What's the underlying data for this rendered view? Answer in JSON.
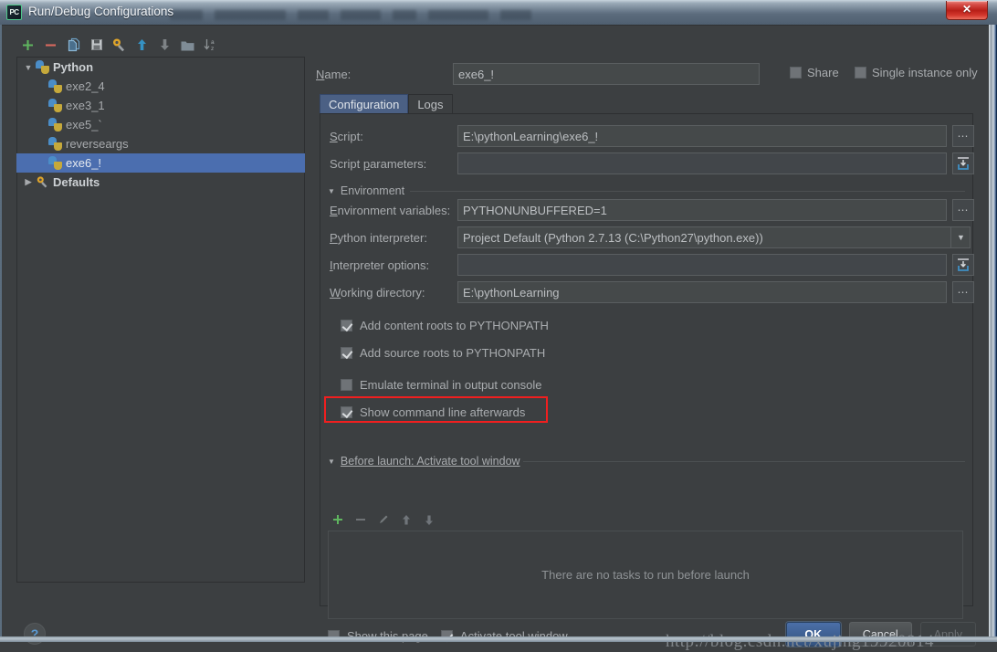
{
  "window": {
    "title": "Run/Debug Configurations",
    "app_icon": "pycharm-icon",
    "close_label": "✕",
    "ghost_menu_widths": [
      36,
      78,
      34,
      44,
      26,
      66,
      34
    ]
  },
  "tree_toolbar": {
    "buttons": [
      {
        "name": "add-configuration-button",
        "icon": "plus-icon",
        "tooltip": "Add New Configuration"
      },
      {
        "name": "remove-configuration-button",
        "icon": "minus-icon",
        "tooltip": "Remove Configuration"
      },
      {
        "name": "copy-configuration-button",
        "icon": "copy-icon",
        "tooltip": "Copy Configuration"
      },
      {
        "name": "save-configuration-button",
        "icon": "save-icon",
        "tooltip": "Save Configuration"
      },
      {
        "name": "edit-defaults-button",
        "icon": "wrench-icon",
        "tooltip": "Edit Defaults"
      },
      {
        "name": "move-up-button",
        "icon": "arrow-up-icon",
        "tooltip": "Move Up"
      },
      {
        "name": "move-down-button",
        "icon": "arrow-down-icon",
        "tooltip": "Move Down"
      },
      {
        "name": "create-folder-button",
        "icon": "folder-icon",
        "tooltip": "Create New Folder"
      },
      {
        "name": "sort-button",
        "icon": "sort-az-icon",
        "tooltip": "Sort Configurations"
      }
    ]
  },
  "tree": {
    "nodes": [
      {
        "label": "Python",
        "type": "group",
        "expanded": true,
        "icon": "python-icon",
        "selected": false
      },
      {
        "label": "exe2_4",
        "type": "leaf",
        "icon": "python-icon",
        "selected": false
      },
      {
        "label": "exe3_1",
        "type": "leaf",
        "icon": "python-icon",
        "selected": false
      },
      {
        "label": "exe5_`",
        "type": "leaf",
        "icon": "python-icon",
        "selected": false
      },
      {
        "label": "reverseargs",
        "type": "leaf",
        "icon": "python-icon",
        "selected": false
      },
      {
        "label": "exe6_!",
        "type": "leaf",
        "icon": "python-icon",
        "selected": true
      },
      {
        "label": "Defaults",
        "type": "group",
        "expanded": false,
        "icon": "wrench-icon",
        "selected": false
      }
    ]
  },
  "name_row": {
    "label": "Name:",
    "value": "exe6_!",
    "placeholder": "",
    "share": {
      "label": "Share",
      "checked": false
    },
    "single_instance": {
      "label": "Single instance only",
      "checked": false
    }
  },
  "tabs": [
    {
      "label": "Configuration",
      "active": true
    },
    {
      "label": "Logs",
      "active": false
    }
  ],
  "configuration": {
    "script": {
      "label": "Script:",
      "value": "E:\\pythonLearning\\exe6_!",
      "browse_icon": "ellipsis-icon"
    },
    "script_parameters": {
      "label": "Script parameters:",
      "value": "",
      "placeholder": "",
      "macro_icon": "insert-macro-icon"
    },
    "environment_section": {
      "label": "Environment",
      "expanded": true
    },
    "environment_variables": {
      "label": "Environment variables:",
      "value": "PYTHONUNBUFFERED=1",
      "browse_icon": "ellipsis-icon"
    },
    "python_interpreter": {
      "label": "Python interpreter:",
      "value": "Project Default (Python 2.7.13 (C:\\Python27\\python.exe))",
      "dropdown_icon": "chevron-down-icon"
    },
    "interpreter_options": {
      "label": "Interpreter options:",
      "value": "",
      "placeholder": "",
      "macro_icon": "insert-macro-icon"
    },
    "working_directory": {
      "label": "Working directory:",
      "value": "E:\\pythonLearning",
      "browse_icon": "ellipsis-icon"
    },
    "checkboxes": [
      {
        "label": "Add content roots to PYTHONPATH",
        "checked": true,
        "highlighted": false
      },
      {
        "label": "Add source roots to PYTHONPATH",
        "checked": true,
        "highlighted": false
      },
      {
        "label": "Emulate terminal in output console",
        "checked": false,
        "highlighted": false
      },
      {
        "label": "Show command line afterwards",
        "checked": true,
        "highlighted": true
      }
    ]
  },
  "before_launch": {
    "section_label": "Before launch: Activate tool window",
    "expanded": true,
    "toolbar": [
      {
        "name": "add-task-button",
        "icon": "plus-icon"
      },
      {
        "name": "remove-task-button",
        "icon": "minus-icon"
      },
      {
        "name": "edit-task-button",
        "icon": "pencil-icon"
      },
      {
        "name": "move-task-up-button",
        "icon": "arrow-up-icon"
      },
      {
        "name": "move-task-down-button",
        "icon": "arrow-down-icon"
      }
    ],
    "empty_text": "There are no tasks to run before launch",
    "footer_checkboxes": [
      {
        "label": "Show this page",
        "checked": false
      },
      {
        "label": "Activate tool window",
        "checked": true
      }
    ]
  },
  "dialog_buttons": {
    "help": "?",
    "ok": "OK",
    "cancel": "Cancel",
    "apply": "Apply",
    "apply_disabled": true
  },
  "watermark": "http://blog.csdn.net/xujing19920814",
  "colors": {
    "background": "#3c3f41",
    "field_background": "#45494a",
    "selection_blue": "#4b6eaf",
    "active_tab": "#4b6084",
    "text_primary": "#a9acaf",
    "text_bright": "#cdd1d4",
    "annotation_red": "#f01f1f",
    "accent_green": "#5fb55f",
    "accent_blue": "#3592c4",
    "close_red": "#b81f18"
  }
}
